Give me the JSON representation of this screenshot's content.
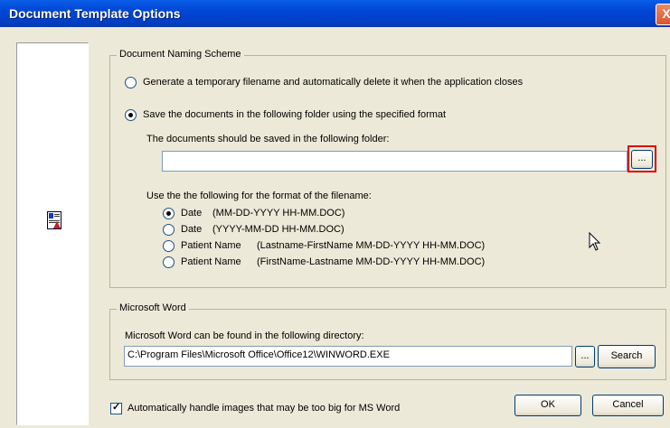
{
  "window": {
    "title": "Document Template Options",
    "close_label": "X"
  },
  "naming": {
    "legend": "Document Naming Scheme",
    "option_temp": "Generate a temporary filename and automatically delete it when the application closes",
    "option_save": "Save the documents in the following folder using the specified format",
    "folder_label": "The documents should be saved in the following folder:",
    "folder_value": "",
    "browse_label": "...",
    "format_label": "Use the the following for the format of the filename:",
    "formats": [
      {
        "name": "Date",
        "pattern": "(MM-DD-YYYY HH-MM.DOC)",
        "selected": true
      },
      {
        "name": "Date",
        "pattern": "(YYYY-MM-DD HH-MM.DOC)",
        "selected": false
      },
      {
        "name": "Patient Name",
        "pattern": "(Lastname-FirstName MM-DD-YYYY HH-MM.DOC)",
        "selected": false
      },
      {
        "name": "Patient Name",
        "pattern": "(FirstName-Lastname MM-DD-YYYY HH-MM.DOC)",
        "selected": false
      }
    ]
  },
  "word": {
    "legend": "Microsoft Word",
    "dir_label": "Microsoft Word can be found in the following directory:",
    "path_value": "C:\\Program Files\\Microsoft Office\\Office12\\WINWORD.EXE",
    "browse_label": "...",
    "search_label": "Search"
  },
  "footer": {
    "auto_images_label": "Automatically handle images that may be too big for MS Word",
    "auto_images_checked": true,
    "ok_label": "OK",
    "cancel_label": "Cancel"
  },
  "colors": {
    "title_bar": "#0046d5",
    "highlight_border": "#e00000"
  },
  "icons": [
    "document-icon",
    "close-icon",
    "mouse-cursor-icon"
  ]
}
